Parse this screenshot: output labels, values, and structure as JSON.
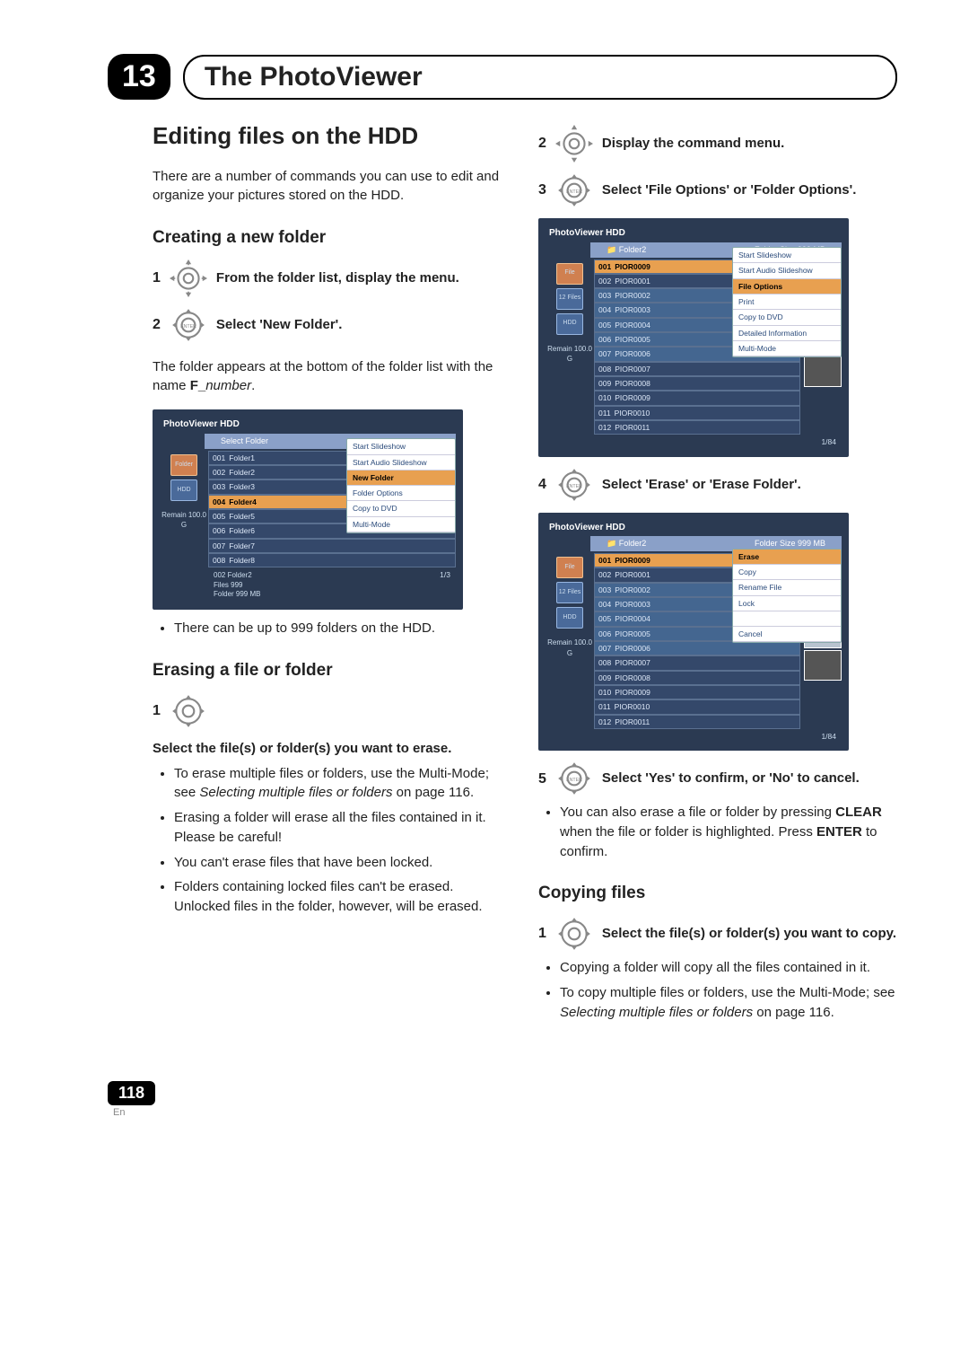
{
  "chapter": {
    "num": "13",
    "title": "The PhotoViewer"
  },
  "section": "Editing files on the HDD",
  "intro": "There are a number of commands you can use to edit and organize your pictures stored on the HDD.",
  "sub_create": "Creating a new folder",
  "create_step1": {
    "num": "1",
    "text": "From the folder list, display the menu."
  },
  "create_step2": {
    "num": "2",
    "text": "Select 'New Folder'."
  },
  "create_step2_body": "The folder appears at the bottom of the folder list with the name ",
  "create_step2_body_bold": "F_",
  "create_step2_body_italic": "number",
  "create_step2_body_end": ".",
  "create_bullet": "There can be up to 999 folders on the HDD.",
  "sub_erase": "Erasing a file or folder",
  "erase_step1": {
    "num": "1",
    "text": "Select the file(s) or folder(s) you want to erase."
  },
  "erase_bullets": [
    {
      "pre": "To erase multiple files or folders, use the Multi-Mode; see ",
      "it": "Selecting multiple files or folders",
      "post": " on page 116."
    },
    {
      "pre": "Erasing a folder will erase all the files contained in it. Please be careful!",
      "it": "",
      "post": ""
    },
    {
      "pre": "You can't erase files that have been locked.",
      "it": "",
      "post": ""
    },
    {
      "pre": "Folders containing locked files can't be erased. Unlocked files in the folder, however, will be erased.",
      "it": "",
      "post": ""
    }
  ],
  "right_step2": {
    "num": "2",
    "text": "Display the command menu."
  },
  "right_step3": {
    "num": "3",
    "text": "Select 'File Options' or 'Folder Options'."
  },
  "right_step4": {
    "num": "4",
    "text": "Select 'Erase' or 'Erase Folder'."
  },
  "right_step5": {
    "num": "5",
    "text": "Select 'Yes' to confirm, or 'No' to cancel."
  },
  "right_bullet5": {
    "pre": "You can also erase a file or folder by pressing ",
    "b1": "CLEAR",
    "mid": " when the file or folder is highlighted. Press ",
    "b2": "ENTER",
    "post": " to confirm."
  },
  "sub_copy": "Copying files",
  "copy_step1": {
    "num": "1",
    "text": "Select the file(s) or folder(s) you want to copy."
  },
  "copy_bullets": [
    {
      "pre": "Copying a folder will copy all the files contained in it.",
      "it": "",
      "post": ""
    },
    {
      "pre": "To copy multiple files or folders, use the Multi-Mode; see ",
      "it": "Selecting multiple files or folders",
      "post": " on page 116."
    }
  ],
  "ss1": {
    "title": "PhotoViewer  HDD",
    "header": "Select Folder",
    "rows": [
      {
        "n": "001",
        "name": "Folder1"
      },
      {
        "n": "002",
        "name": "Folder2"
      },
      {
        "n": "003",
        "name": "Folder3"
      },
      {
        "n": "004",
        "name": "Folder4"
      },
      {
        "n": "005",
        "name": "Folder5"
      },
      {
        "n": "006",
        "name": "Folder6"
      },
      {
        "n": "007",
        "name": "Folder7"
      },
      {
        "n": "008",
        "name": "Folder8"
      }
    ],
    "menu": [
      "Start Slideshow",
      "Start Audio Slideshow",
      "New Folder",
      "Folder Options",
      "Copy to DVD",
      "Multi-Mode"
    ],
    "menu_hl": 2,
    "side": [
      {
        "l": "Folder",
        "sel": true
      },
      {
        "l": "HDD"
      }
    ],
    "remain": "Remain\n100.0 G",
    "meta": [
      "002 Folder2",
      "Files        999",
      "Folder     999 MB"
    ],
    "page": "1/3"
  },
  "ss2": {
    "title": "PhotoViewer  HDD",
    "headerL": "Folder2",
    "headerR": "Folder Size 999 MB",
    "rows": [
      {
        "n": "001",
        "name": "PIOR0009"
      },
      {
        "n": "002",
        "name": "PIOR0001"
      },
      {
        "n": "003",
        "name": "PIOR0002"
      },
      {
        "n": "004",
        "name": "PIOR0003"
      },
      {
        "n": "005",
        "name": "PIOR0004"
      },
      {
        "n": "006",
        "name": "PIOR0005"
      },
      {
        "n": "007",
        "name": "PIOR0006"
      },
      {
        "n": "008",
        "name": "PIOR0007"
      },
      {
        "n": "009",
        "name": "PIOR0008"
      },
      {
        "n": "010",
        "name": "PIOR0009"
      },
      {
        "n": "011",
        "name": "PIOR0010"
      },
      {
        "n": "012",
        "name": "PIOR0011"
      }
    ],
    "menu": [
      "Start Slideshow",
      "Start Audio Slideshow",
      "File Options",
      "Print",
      "Copy to DVD",
      "Detailed Information",
      "Multi-Mode"
    ],
    "menu_hl": 2,
    "side": [
      {
        "l": "File",
        "sel": true
      },
      {
        "l": "12 Files"
      },
      {
        "l": "HDD"
      }
    ],
    "remain": "Remain\n100.0 G",
    "page": "1/84"
  },
  "ss3": {
    "title": "PhotoViewer  HDD",
    "headerL": "Folder2",
    "headerR": "Folder Size 999 MB",
    "rows": [
      {
        "n": "001",
        "name": "PIOR0009"
      },
      {
        "n": "002",
        "name": "PIOR0001"
      },
      {
        "n": "003",
        "name": "PIOR0002"
      },
      {
        "n": "004",
        "name": "PIOR0003"
      },
      {
        "n": "005",
        "name": "PIOR0004"
      },
      {
        "n": "006",
        "name": "PIOR0005"
      },
      {
        "n": "007",
        "name": "PIOR0006"
      },
      {
        "n": "008",
        "name": "PIOR0007"
      },
      {
        "n": "009",
        "name": "PIOR0008"
      },
      {
        "n": "010",
        "name": "PIOR0009"
      },
      {
        "n": "011",
        "name": "PIOR0010"
      },
      {
        "n": "012",
        "name": "PIOR0011"
      }
    ],
    "menu": [
      "Erase",
      "Copy",
      "Rename File",
      "Lock",
      "",
      "Cancel"
    ],
    "menu_hl": 0,
    "side": [
      {
        "l": "File",
        "sel": true
      },
      {
        "l": "12 Files"
      },
      {
        "l": "HDD"
      }
    ],
    "remain": "Remain\n100.0 G",
    "page": "1/84"
  },
  "footer": {
    "page": "118",
    "lang": "En"
  }
}
